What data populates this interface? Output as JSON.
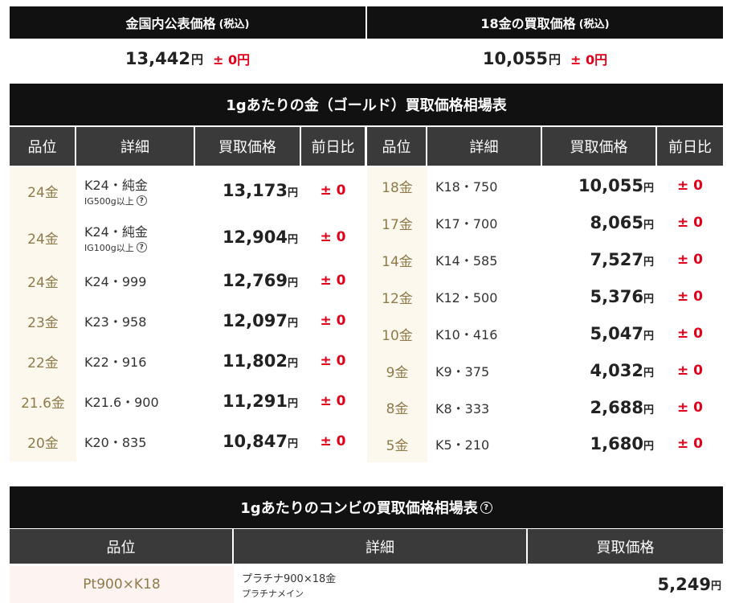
{
  "summary": {
    "left": {
      "title": "金国内公表価格",
      "tax": "(税込)",
      "value": "13,442",
      "unit": "円",
      "change": "± 0円"
    },
    "right": {
      "title": "18金の買取価格",
      "tax": "(税込)",
      "value": "10,055",
      "unit": "円",
      "change": "± 0円"
    }
  },
  "gold_table": {
    "title": "1gあたりの金（ゴールド）買取価格相場表",
    "headers": [
      "品位",
      "詳細",
      "買取価格",
      "前日比"
    ],
    "left_rows": [
      {
        "grade": "24金",
        "detail": "K24・純金",
        "sub": "IG500g以上",
        "price": "13,173",
        "unit": "円",
        "change": "± 0"
      },
      {
        "grade": "24金",
        "detail": "K24・純金",
        "sub": "IG100g以上",
        "price": "12,904",
        "unit": "円",
        "change": "± 0"
      },
      {
        "grade": "24金",
        "detail": "K24・999",
        "sub": "",
        "price": "12,769",
        "unit": "円",
        "change": "± 0"
      },
      {
        "grade": "23金",
        "detail": "K23・958",
        "sub": "",
        "price": "12,097",
        "unit": "円",
        "change": "± 0"
      },
      {
        "grade": "22金",
        "detail": "K22・916",
        "sub": "",
        "price": "11,802",
        "unit": "円",
        "change": "± 0"
      },
      {
        "grade": "21.6金",
        "detail": "K21.6・900",
        "sub": "",
        "price": "11,291",
        "unit": "円",
        "change": "± 0"
      },
      {
        "grade": "20金",
        "detail": "K20・835",
        "sub": "",
        "price": "10,847",
        "unit": "円",
        "change": "± 0"
      }
    ],
    "right_rows": [
      {
        "grade": "18金",
        "detail": "K18・750",
        "price": "10,055",
        "unit": "円",
        "change": "± 0"
      },
      {
        "grade": "17金",
        "detail": "K17・700",
        "price": "8,065",
        "unit": "円",
        "change": "± 0"
      },
      {
        "grade": "14金",
        "detail": "K14・585",
        "price": "7,527",
        "unit": "円",
        "change": "± 0"
      },
      {
        "grade": "12金",
        "detail": "K12・500",
        "price": "5,376",
        "unit": "円",
        "change": "± 0"
      },
      {
        "grade": "10金",
        "detail": "K10・416",
        "price": "5,047",
        "unit": "円",
        "change": "± 0"
      },
      {
        "grade": "9金",
        "detail": "K9・375",
        "price": "4,032",
        "unit": "円",
        "change": "± 0"
      },
      {
        "grade": "8金",
        "detail": "K8・333",
        "price": "2,688",
        "unit": "円",
        "change": "± 0"
      },
      {
        "grade": "5金",
        "detail": "K5・210",
        "price": "1,680",
        "unit": "円",
        "change": "± 0"
      }
    ]
  },
  "combo_table": {
    "title": "1gあたりのコンビの買取価格相場表",
    "headers": [
      "品位",
      "詳細",
      "買取価格"
    ],
    "rows": [
      {
        "grade": "Pt900×K18",
        "detail": "プラチナ900×18金",
        "sub": "プラチナメイン",
        "price": "5,249",
        "unit": "円"
      }
    ]
  },
  "icons": {
    "help": "question-circle-icon"
  },
  "colors": {
    "header_dark": "#111111",
    "header_gray": "#3a3a3a",
    "change_red": "#e1001a",
    "grade_gold": "#8f7a4a",
    "row_cream": "#fcf8ee",
    "row_pink": "#fdf4f1"
  }
}
